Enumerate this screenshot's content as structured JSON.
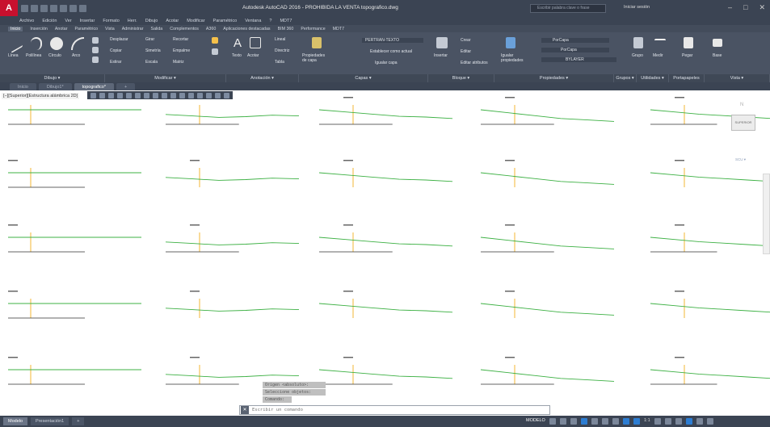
{
  "app": {
    "logo": "A",
    "title": "Autodesk AutoCAD 2016 - PROHIBIDA LA VENTA    topografico.dwg",
    "search_placeholder": "Escribir palabra clave o frase",
    "login": "Iniciar sesión",
    "win_min": "–",
    "win_max": "□",
    "win_close": "✕"
  },
  "menu": [
    "Archivo",
    "Edición",
    "Ver",
    "Insertar",
    "Formato",
    "Herr.",
    "Dibujo",
    "Acotar",
    "Modificar",
    "Paramétrico",
    "Ventana",
    "?",
    "MDT7"
  ],
  "ribbon_tabs": [
    "Inicio",
    "Inserción",
    "Anotar",
    "Paramétrico",
    "Vista",
    "Administrar",
    "Salida",
    "Complementos",
    "A360",
    "Aplicaciones destacadas",
    "BIM 360",
    "Performance",
    "MDT7"
  ],
  "ribbon": {
    "draw": [
      "Línea",
      "Polilínea",
      "Círculo",
      "Arco"
    ],
    "modify": [
      "Desplazar",
      "Girar",
      "Recortar",
      "Copiar",
      "Simetría",
      "Empalme",
      "Estirar",
      "Escala",
      "Matriz"
    ],
    "annotation": [
      "Texto",
      "Acotar",
      "Lineal",
      "Directriz",
      "Tabla"
    ],
    "layers": [
      "Propiedades de capa",
      "PERTRAN-TEXTO",
      "Establecer como actual",
      "Igualar capa"
    ],
    "block": [
      "Insertar",
      "Crear",
      "Editar",
      "Editar atributos"
    ],
    "properties": [
      "Igualar propiedades",
      "PorCapa",
      "PorCapa",
      "BYLAYER"
    ],
    "groups": [
      "Grupo"
    ],
    "utilities": [
      "Medir"
    ],
    "clipboard": [
      "Pegar"
    ],
    "view": [
      "Base"
    ]
  },
  "ribbon_groups": [
    "Dibujo ▾",
    "Modificar ▾",
    "Anotación ▾",
    "Capas ▾",
    "Bloque ▾",
    "Propiedades ▾",
    "Grupos ▾",
    "Utilidades ▾",
    "Portapapeles",
    "Vista ▾"
  ],
  "doc_tabs": [
    "Inicio",
    "Dibujo1*",
    "topografico*",
    "+"
  ],
  "viewport_label": "[−][Superior][Estructura alámbrica 2D]",
  "viewcube": {
    "face": "SUPERIOR",
    "north": "N",
    "ucs": "SCU ▾"
  },
  "command": {
    "history": [
      "Origen <absoluto>:",
      "Seleccione objetos:",
      "Comando:"
    ],
    "placeholder": "Escribir un comando",
    "close": "✕"
  },
  "status": {
    "layout_tabs": [
      "Modelo",
      "Presentación1",
      "+"
    ],
    "mode": "MODELO",
    "scale": "1:1"
  },
  "colors": {
    "profile": "#3cb043",
    "axis": "#f0a500",
    "ground": "#333333"
  }
}
